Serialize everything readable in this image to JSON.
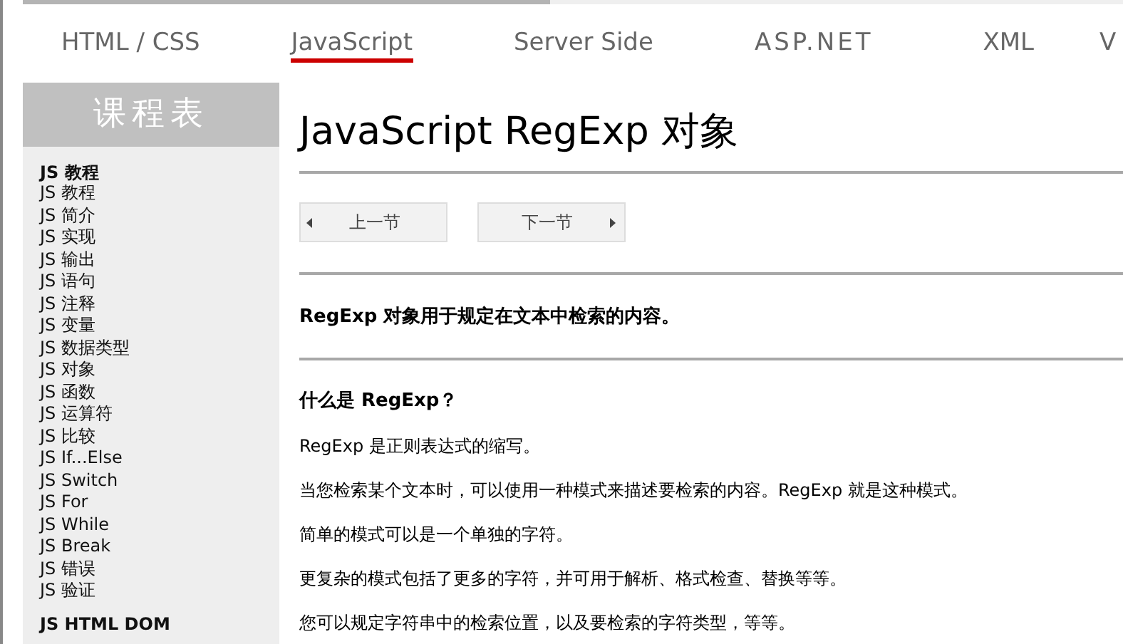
{
  "tabs": [
    {
      "label": "HTML / CSS",
      "selected": false
    },
    {
      "label": "JavaScript",
      "selected": true
    },
    {
      "label": "Server Side",
      "selected": false
    },
    {
      "label": "ASP.NET",
      "selected": false
    },
    {
      "label": "XML",
      "selected": false
    },
    {
      "label": "V",
      "selected": false
    }
  ],
  "sidebar": {
    "title": "课程表",
    "sections": [
      {
        "heading": "JS 教程",
        "items": [
          "JS 教程",
          "JS 简介",
          "JS 实现",
          "JS 输出",
          "JS 语句",
          "JS 注释",
          "JS 变量",
          "JS 数据类型",
          "JS 对象",
          "JS 函数",
          "JS 运算符",
          "JS 比较",
          "JS If...Else",
          "JS Switch",
          "JS For",
          "JS While",
          "JS Break",
          "JS 错误",
          "JS 验证"
        ]
      },
      {
        "heading": "JS HTML DOM"
      }
    ]
  },
  "article": {
    "title": "JavaScript RegExp 对象",
    "prev_button": "上一节",
    "next_button": "下一节",
    "intro": "RegExp 对象用于规定在文本中检索的内容。",
    "heading": "什么是 RegExp？",
    "paragraphs": [
      "RegExp 是正则表达式的缩写。",
      "当您检索某个文本时，可以使用一种模式来描述要检索的内容。RegExp 就是这种模式。",
      "简单的模式可以是一个单独的字符。",
      "更复杂的模式包括了更多的字符，并可用于解析、格式检查、替换等等。",
      "您可以规定字符串中的检索位置，以及要检索的字符类型，等等。"
    ]
  }
}
